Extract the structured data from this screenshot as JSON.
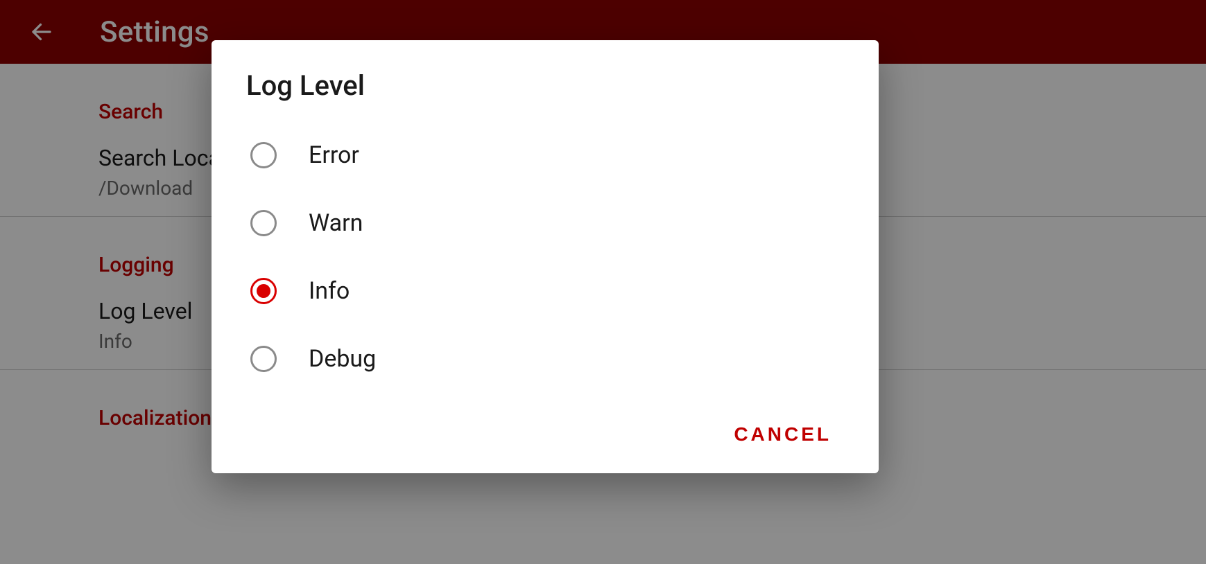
{
  "colors": {
    "appbar": "#8c0000",
    "accent": "#c00000",
    "radioSelected": "#d90000"
  },
  "appbar": {
    "title": "Settings"
  },
  "settings": {
    "sections": [
      {
        "header": "Search",
        "items": [
          {
            "label": "Search Location",
            "value": "/Download"
          }
        ]
      },
      {
        "header": "Logging",
        "items": [
          {
            "label": "Log Level",
            "value": "Info"
          }
        ]
      },
      {
        "header": "Localization",
        "items": []
      }
    ]
  },
  "dialog": {
    "title": "Log Level",
    "options": [
      {
        "label": "Error",
        "selected": false
      },
      {
        "label": "Warn",
        "selected": false
      },
      {
        "label": "Info",
        "selected": true
      },
      {
        "label": "Debug",
        "selected": false
      }
    ],
    "cancel_label": "CANCEL"
  }
}
